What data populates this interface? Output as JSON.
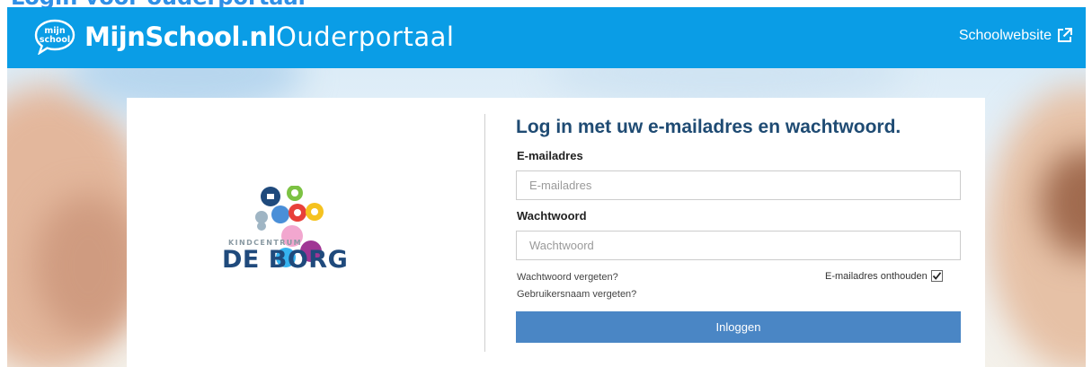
{
  "page_heading_fragment": "Login voor ouderportaal",
  "header": {
    "logo_text_line1": "mijn",
    "logo_text_line2": "school",
    "brand_bold": "MijnSchool.nl",
    "brand_thin": "Ouderportaal",
    "school_link_label": "Schoolwebsite",
    "link_icon": "external-link-icon"
  },
  "school": {
    "name_small": "KINDCENTRUM",
    "name_large": "DE BORG"
  },
  "login": {
    "title": "Log in met uw e-mailadres en wachtwoord.",
    "email_label": "E-mailadres",
    "email_placeholder": "E-mailadres",
    "email_value": "",
    "password_label": "Wachtwoord",
    "password_placeholder": "Wachtwoord",
    "password_value": "",
    "forgot_password": "Wachtwoord vergeten?",
    "forgot_username": "Gebruikersnaam vergeten?",
    "remember_label": "E-mailadres onthouden",
    "remember_checked": true,
    "submit_label": "Inloggen"
  },
  "colors": {
    "header_bg": "#0a9de6",
    "title_color": "#1f4b73",
    "button_bg": "#4a86c5",
    "school_name_color": "#1f4a7c"
  }
}
